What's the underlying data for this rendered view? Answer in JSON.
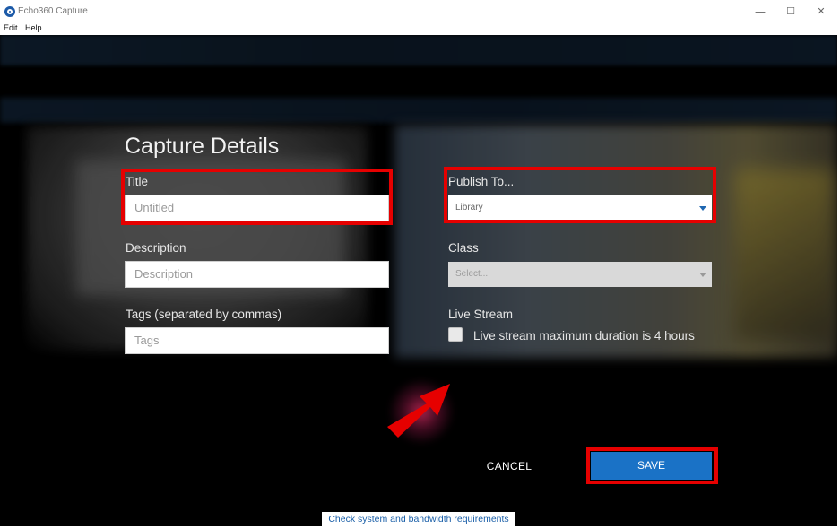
{
  "window": {
    "title": "Echo360 Capture",
    "minimize_glyph": "—",
    "maximize_glyph": "☐",
    "close_glyph": "✕"
  },
  "menu": {
    "items": [
      "Edit",
      "Help"
    ]
  },
  "form": {
    "heading": "Capture Details",
    "title": {
      "label": "Title",
      "placeholder": "Untitled"
    },
    "description": {
      "label": "Description",
      "placeholder": "Description"
    },
    "tags": {
      "label": "Tags (separated by commas)",
      "placeholder": "Tags"
    },
    "publish_to": {
      "label": "Publish To...",
      "selected": "Library"
    },
    "class": {
      "label": "Class",
      "selected": "Select..."
    },
    "live_stream": {
      "label": "Live Stream",
      "checkbox_label": "Live stream maximum duration is 4 hours",
      "checked": false
    }
  },
  "actions": {
    "cancel_label": "CANCEL",
    "save_label": "SAVE"
  },
  "footer": {
    "check_link": "Check system and bandwidth requirements"
  },
  "colors": {
    "accent": "#1a72c6",
    "annotation": "#e60000",
    "background": "#000000"
  }
}
